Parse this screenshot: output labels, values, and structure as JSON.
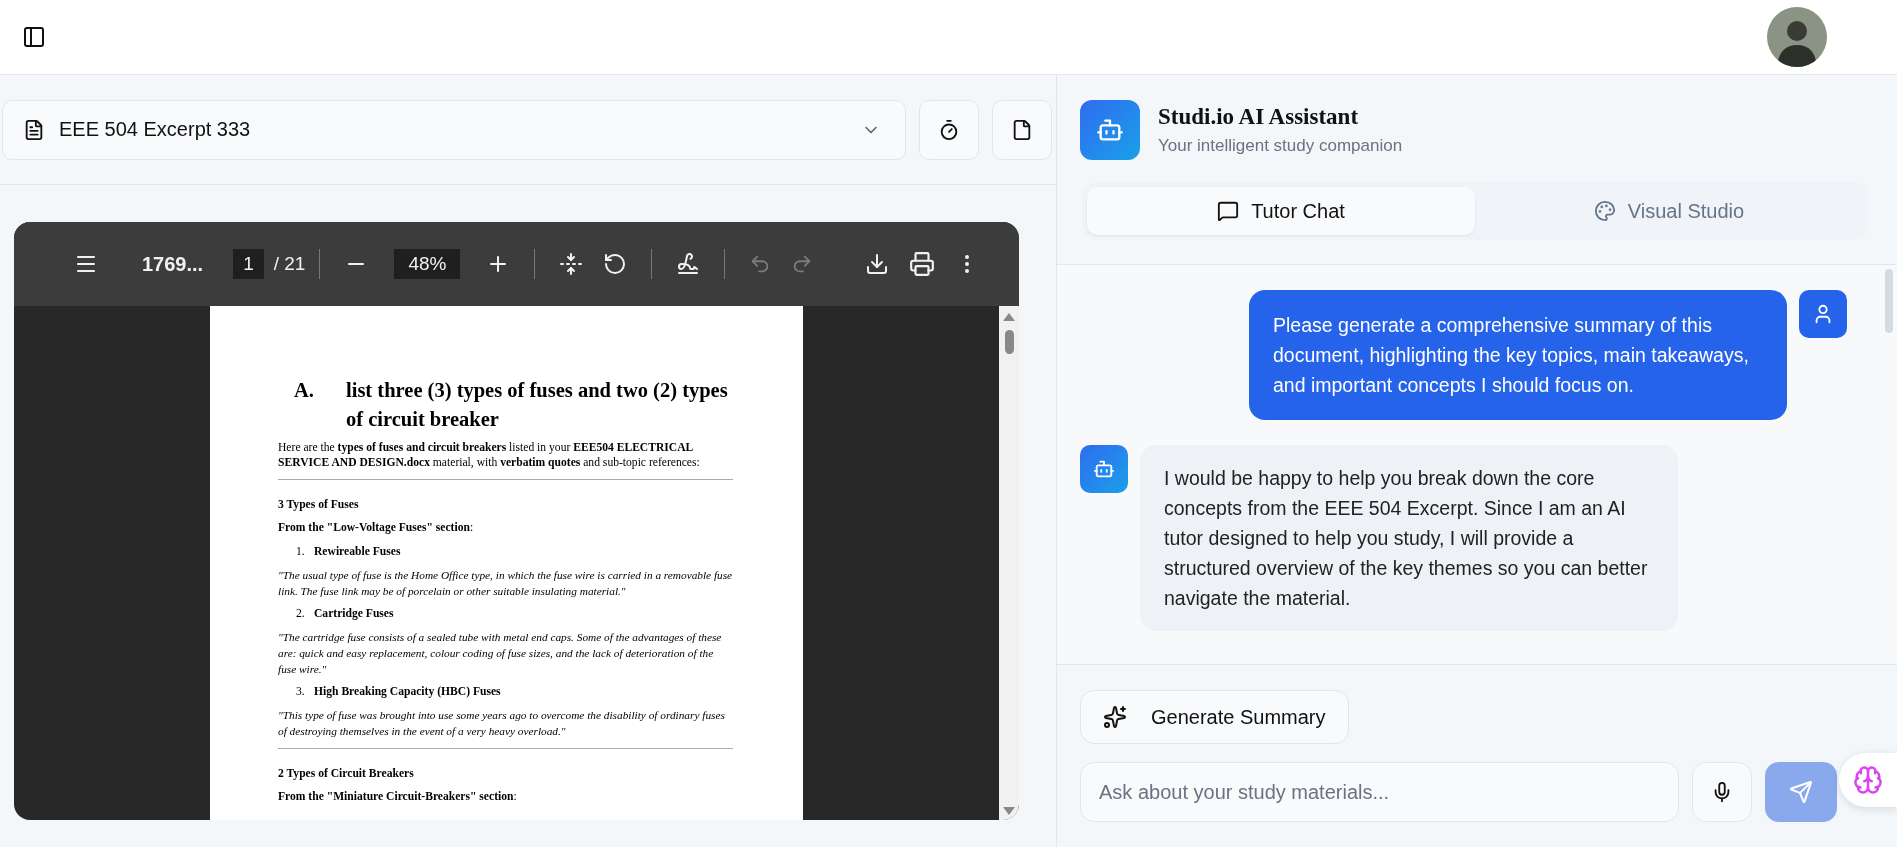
{
  "document_select": {
    "value": "EEE 504 Excerpt 333"
  },
  "pdf_viewer": {
    "file_name": "1769...",
    "page": "1",
    "page_total": "/ 21",
    "zoom": "48%",
    "content": [
      {
        "kind": "heading",
        "marker": "A.",
        "text": "list three (3) types of fuses and two (2) types of circuit breaker"
      },
      {
        "kind": "paragraph",
        "text": "Here are the **types of fuses and circuit breakers** listed in your **EEE504 ELECTRICAL SERVICE AND DESIGN.docx** material, with **verbatim quotes** and sub-topic references:"
      },
      {
        "kind": "rule"
      },
      {
        "kind": "subheading",
        "text": "3 Types of Fuses"
      },
      {
        "kind": "paragraph",
        "text": "**From the \"Low-Voltage Fuses\" section**:"
      },
      {
        "kind": "item",
        "number": "1.",
        "text": "Rewireable Fuses"
      },
      {
        "kind": "quote",
        "text": "\"The usual type of fuse is the Home Office type, in which the fuse wire is carried in a removable fuse link. The fuse link may be of porcelain or other suitable insulating material.\""
      },
      {
        "kind": "item",
        "number": "2.",
        "text": "Cartridge Fuses"
      },
      {
        "kind": "quote",
        "text": "\"The cartridge fuse consists of a sealed tube with metal end caps. Some of the advantages of these are: quick and easy replacement, colour coding of fuse sizes, and the lack of deterioration of the fuse wire.\""
      },
      {
        "kind": "item",
        "number": "3.",
        "text": "High Breaking Capacity (HBC) Fuses"
      },
      {
        "kind": "quote",
        "text": "\"This type of fuse was brought into use some years ago to overcome the disability of ordinary fuses of destroying themselves in the event of a very heavy overload.\""
      },
      {
        "kind": "rule"
      },
      {
        "kind": "subheading",
        "text": "2 Types of Circuit Breakers"
      },
      {
        "kind": "paragraph",
        "text": "**From the \"Miniature Circuit-Breakers\" section**:"
      }
    ]
  },
  "assistant": {
    "title": "Studi.io AI Assistant",
    "subtitle": "Your intelligent study companion"
  },
  "tabs": [
    {
      "label": "Tutor Chat",
      "selected": true
    },
    {
      "label": "Visual Studio",
      "selected": false
    }
  ],
  "messages": [
    {
      "kind": "user",
      "text": "Please generate a comprehensive summary of this document, highlighting the key topics, main takeaways, and important concepts I should focus on."
    },
    {
      "kind": "bot",
      "text": "I would be happy to help you break down the core concepts from the EEE 504 Excerpt. Since I am an AI tutor designed to help you study, I will provide a structured overview of the key themes so you can better navigate the material."
    }
  ],
  "generate_button": "Generate Summary",
  "chat_input": {
    "placeholder": "Ask about your study materials..."
  }
}
